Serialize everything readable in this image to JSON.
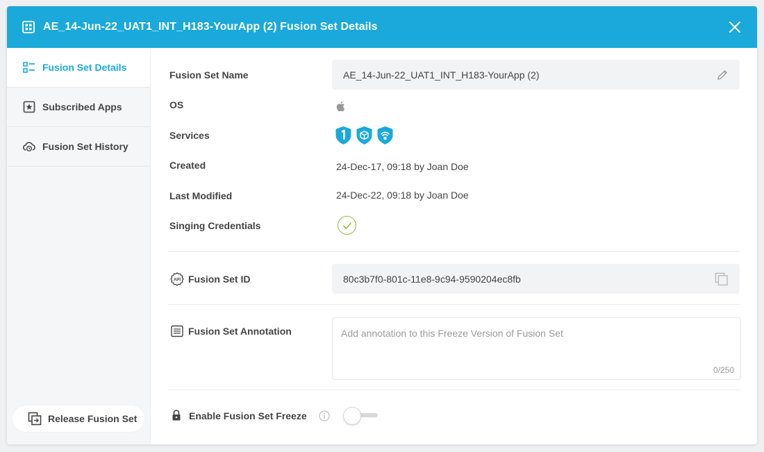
{
  "header": {
    "title": "AE_14-Jun-22_UAT1_INT_H183-YourApp (2)  Fusion Set Details",
    "accent": "#1aa9da"
  },
  "sidebar": {
    "items": [
      {
        "label": "Fusion Set Details",
        "icon": "list-detail-icon",
        "active": true
      },
      {
        "label": "Subscribed Apps",
        "icon": "star-box-icon",
        "active": false
      },
      {
        "label": "Fusion Set History",
        "icon": "cloud-history-icon",
        "active": false
      }
    ],
    "release_button": "Release Fusion Set"
  },
  "details": {
    "name_label": "Fusion Set Name",
    "name_value": "AE_14-Jun-22_UAT1_INT_H183-YourApp (2)",
    "os_label": "OS",
    "os_icon": "apple-icon",
    "services_label": "Services",
    "services_icons": [
      "shield-one-icon",
      "cube-shield-icon",
      "wifi-shield-icon"
    ],
    "created_label": "Created",
    "created_value": "24-Dec-17, 09:18  by Joan Doe",
    "modified_label": "Last Modified",
    "modified_value": "24-Dec-22, 09:18  by Joan Doe",
    "credentials_label": "Singing Credentials",
    "credentials_status": "check-icon"
  },
  "fusion_id": {
    "label": "Fusion Set ID",
    "value": "80c3b7f0-801c-11e8-9c94-9590204ec8fb"
  },
  "annotation": {
    "label": "Fusion Set Annotation",
    "placeholder": "Add annotation to this Freeze Version of Fusion Set",
    "counter": "0/250"
  },
  "freeze": {
    "label": "Enable Fusion Set Freeze",
    "enabled": false
  }
}
